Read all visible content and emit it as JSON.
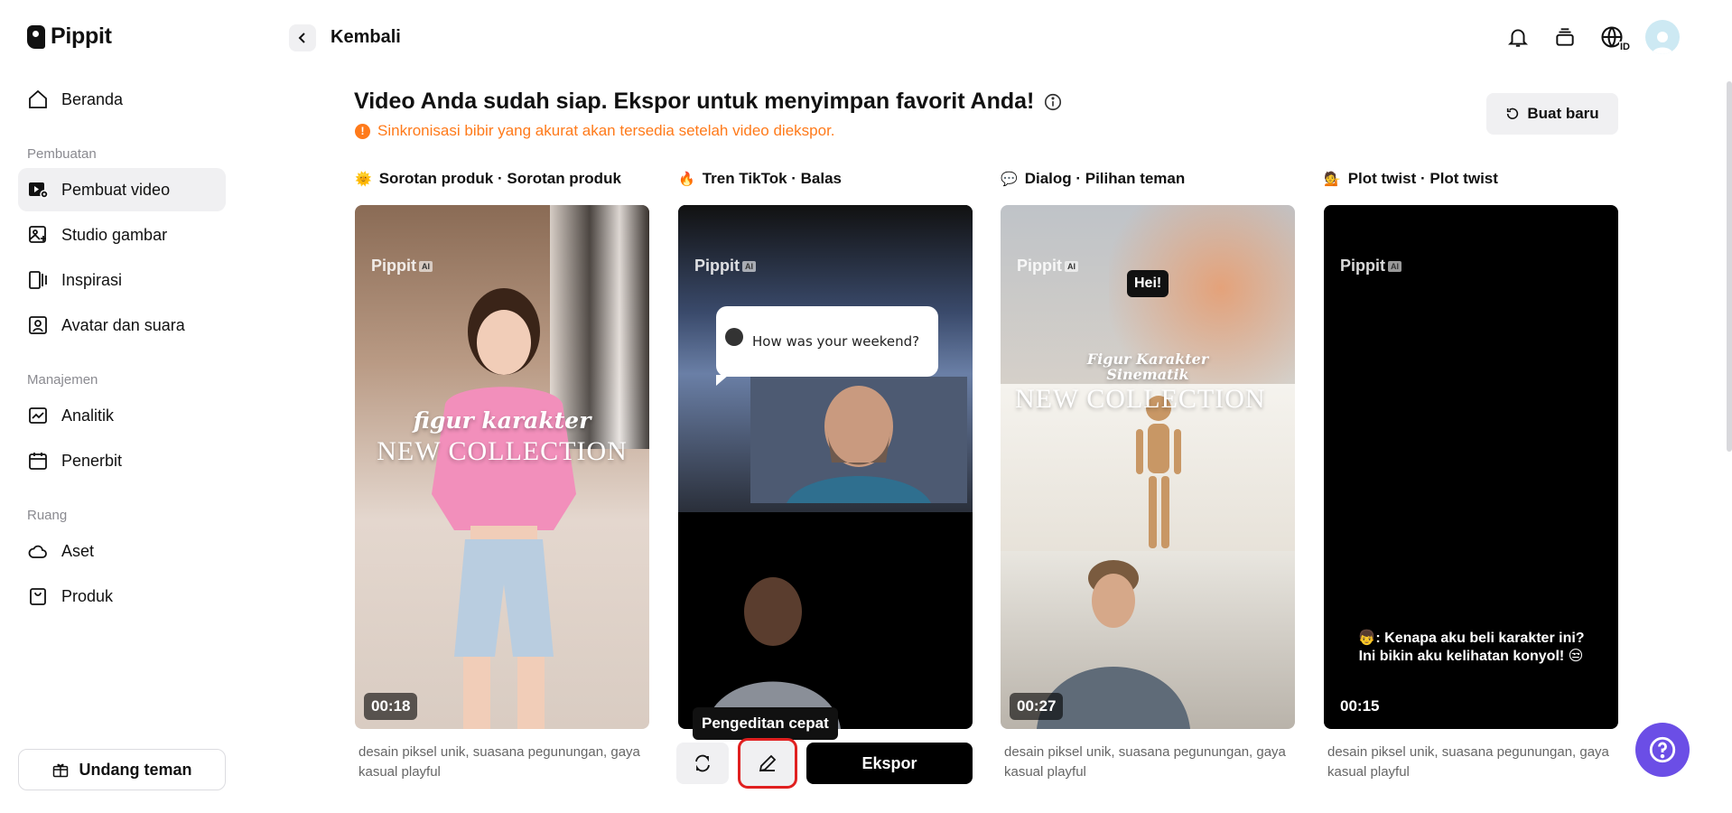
{
  "app": {
    "name": "Pippit"
  },
  "sidebar": {
    "items": [
      {
        "label": "Beranda",
        "icon": "home-icon"
      },
      {
        "label": "Pembuat video",
        "icon": "video-maker-icon",
        "active": true
      },
      {
        "label": "Studio gambar",
        "icon": "image-studio-icon"
      },
      {
        "label": "Inspirasi",
        "icon": "inspiration-icon"
      },
      {
        "label": "Avatar dan suara",
        "icon": "avatar-voice-icon"
      },
      {
        "label": "Analitik",
        "icon": "analytics-icon"
      },
      {
        "label": "Penerbit",
        "icon": "calendar-icon"
      },
      {
        "label": "Aset",
        "icon": "cloud-icon"
      },
      {
        "label": "Produk",
        "icon": "product-bag-icon"
      }
    ],
    "sections": [
      "Pembuatan",
      "Manajemen",
      "Ruang"
    ],
    "invite_label": "Undang teman"
  },
  "topbar": {
    "back_label": "Kembali",
    "lang_badge": "ID"
  },
  "header": {
    "title": "Video Anda sudah siap. Ekspor untuk menyimpan favorit Anda!",
    "notice": "Sinkronisasi bibir yang akurat akan tersedia setelah video diekspor.",
    "notice_icon": "!",
    "new_button": "Buat baru"
  },
  "cards": [
    {
      "emoji": "🌞",
      "label": "Sorotan produk · Sorotan produk",
      "duration": "00:18",
      "overlay_script": "figur karakter",
      "overlay_big": "NEW COLLECTION",
      "desc": "desain piksel unik, suasana pegunungan, gaya kasual playful"
    },
    {
      "emoji": "🔥",
      "label": "Tren TikTok · Balas",
      "bubble": "How was your weekend?",
      "tooltip": "Pengeditan cepat",
      "export": "Ekspor"
    },
    {
      "emoji": "💬",
      "label": "Dialog · Pilihan teman",
      "duration": "00:27",
      "hei": "Hei!",
      "overlay_script": "Figur Karakter Sinematik",
      "overlay_big": "NEW COLLECTION",
      "desc": "desain piksel unik, suasana pegunungan, gaya kasual playful"
    },
    {
      "emoji": "💁",
      "label": "Plot twist · Plot twist",
      "duration": "00:15",
      "caption_line1": "👦: Kenapa aku beli karakter ini?",
      "caption_line2": "Ini bikin aku kelihatan konyol! 😒",
      "desc": "desain piksel unik, suasana pegunungan, gaya kasual playful"
    }
  ],
  "watermark": {
    "text": "Pippit",
    "badge": "AI"
  },
  "colors": {
    "accent": "#ff7a1a",
    "help": "#6b4ee6",
    "highlight": "#e02020"
  }
}
